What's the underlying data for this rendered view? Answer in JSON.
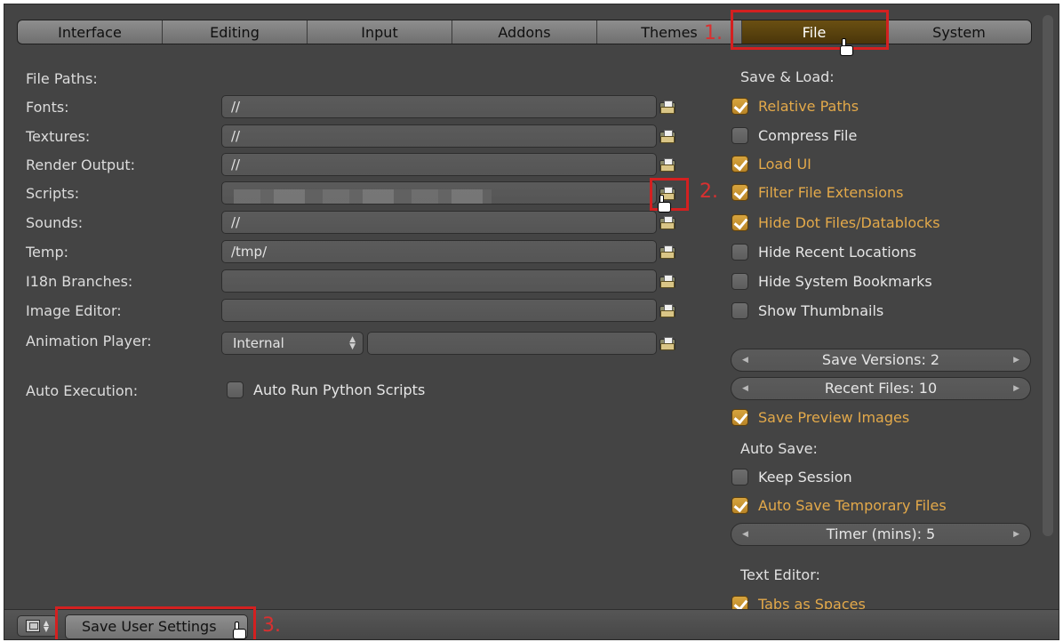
{
  "tabs": [
    {
      "label": "Interface"
    },
    {
      "label": "Editing"
    },
    {
      "label": "Input"
    },
    {
      "label": "Addons"
    },
    {
      "label": "Themes"
    },
    {
      "label": "File",
      "active": true
    },
    {
      "label": "System"
    }
  ],
  "file_paths": {
    "heading": "File Paths:",
    "rows": [
      {
        "label": "Fonts:",
        "value": "//"
      },
      {
        "label": "Textures:",
        "value": "//"
      },
      {
        "label": "Render Output:",
        "value": "//"
      },
      {
        "label": "Scripts:",
        "value": ""
      },
      {
        "label": "Sounds:",
        "value": "//"
      },
      {
        "label": "Temp:",
        "value": "/tmp/"
      },
      {
        "label": "I18n Branches:",
        "value": ""
      },
      {
        "label": "Image Editor:",
        "value": ""
      }
    ],
    "animation_player": {
      "label": "Animation Player:",
      "selected": "Internal",
      "value": ""
    },
    "auto_execution": {
      "label": "Auto Execution:",
      "checkbox_label": "Auto Run Python Scripts",
      "checked": false
    }
  },
  "save_load": {
    "heading": "Save & Load:",
    "options": [
      {
        "label": "Relative Paths",
        "checked": true
      },
      {
        "label": "Compress File",
        "checked": false
      },
      {
        "label": "Load UI",
        "checked": true
      },
      {
        "label": "Filter File Extensions",
        "checked": true
      },
      {
        "label": "Hide Dot Files/Datablocks",
        "checked": true
      },
      {
        "label": "Hide Recent Locations",
        "checked": false
      },
      {
        "label": "Hide System Bookmarks",
        "checked": false
      },
      {
        "label": "Show Thumbnails",
        "checked": false
      }
    ],
    "save_versions": "Save Versions: 2",
    "recent_files": "Recent Files: 10",
    "save_preview": {
      "label": "Save Preview Images",
      "checked": true
    }
  },
  "auto_save": {
    "heading": "Auto Save:",
    "keep_session": {
      "label": "Keep Session",
      "checked": false
    },
    "auto_save_temp": {
      "label": "Auto Save Temporary Files",
      "checked": true
    },
    "timer": "Timer (mins): 5"
  },
  "text_editor": {
    "heading": "Text Editor:",
    "tabs_as_spaces": {
      "label": "Tabs as Spaces",
      "checked": true
    }
  },
  "bottom_bar": {
    "save_label": "Save User Settings"
  },
  "annotations": [
    "1.",
    "2.",
    "3."
  ],
  "colors": {
    "accent": "#e3a94a",
    "annotation": "#d42020",
    "active_tab": "#5a420e"
  }
}
